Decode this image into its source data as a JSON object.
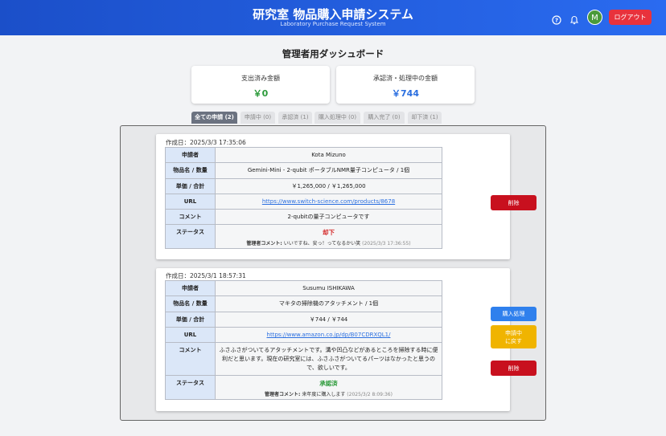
{
  "header": {
    "title": "研究室 物品購入申請システム",
    "subtitle": "Laboratory Purchase Request System",
    "avatar_initial": "M",
    "logout_label": "ログアウト"
  },
  "dashboard": {
    "title": "管理者用ダッシュボード",
    "spent_label": "支出済み金額",
    "spent_value": "￥0",
    "pending_label": "承認済・処理中の金額",
    "pending_value": "￥744"
  },
  "tabs": [
    {
      "label": "全ての申請 (2)",
      "active": true
    },
    {
      "label": "申請中 (0)",
      "active": false
    },
    {
      "label": "承認済 (1)",
      "active": false
    },
    {
      "label": "購入処理中 (0)",
      "active": false
    },
    {
      "label": "購入完了 (0)",
      "active": false
    },
    {
      "label": "却下済 (1)",
      "active": false
    }
  ],
  "requests": [
    {
      "created": "作成日：2025/3/3 17:35:06",
      "labels": {
        "applicant": "申請者",
        "item": "物品名 / 数量",
        "price": "単価 / 合計",
        "url": "URL",
        "comment": "コメント",
        "status": "ステータス"
      },
      "applicant": "Kota Mizuno",
      "item": "Gemini-Mini - 2-qubit ポータブルNMR量子コンピュータ / 1個",
      "price": "￥1,265,000 / ￥1,265,000",
      "url": "https://www.switch-science.com/products/8678",
      "comment": "2-qubitの量子コンピュータです",
      "status": "却下",
      "admin_comment_label": "管理者コメント:",
      "admin_comment": "いいですね、安っ！ってなるかい笑",
      "admin_comment_ts": "(2025/3/3 17:36:55)",
      "buttons": {
        "delete": "削除"
      }
    },
    {
      "created": "作成日：2025/3/1 18:57:31",
      "labels": {
        "applicant": "申請者",
        "item": "物品名 / 数量",
        "price": "単価 / 合計",
        "url": "URL",
        "comment": "コメント",
        "status": "ステータス"
      },
      "applicant": "Susumu ISHIKAWA",
      "item": "マキタの掃除機のアタッチメント / 1個",
      "price": "￥744 / ￥744",
      "url": "https://www.amazon.co.jp/dp/B07CDRXQL1/",
      "comment": "ふさふさがついてるアタッチメントです。溝や凹凸などがあるところを掃除する時に便利だと思います。現在の研究室には、ふさふさがついてるパーツはなかったと思うので、欲しいです。",
      "status": "承認済",
      "admin_comment_label": "管理者コメント:",
      "admin_comment": "来年度に購入します",
      "admin_comment_ts": "(2025/3/2 8:09:36)",
      "buttons": {
        "purchase": "購入処理",
        "revert_line1": "申請中",
        "revert_line2": "に戻す",
        "delete": "削除"
      }
    }
  ],
  "colors": {
    "header": "#1b4fc9",
    "spent": "#2c9a3a",
    "pending": "#2b6fe0",
    "rejected": "#d42a2a",
    "approved": "#2c9a3a"
  }
}
